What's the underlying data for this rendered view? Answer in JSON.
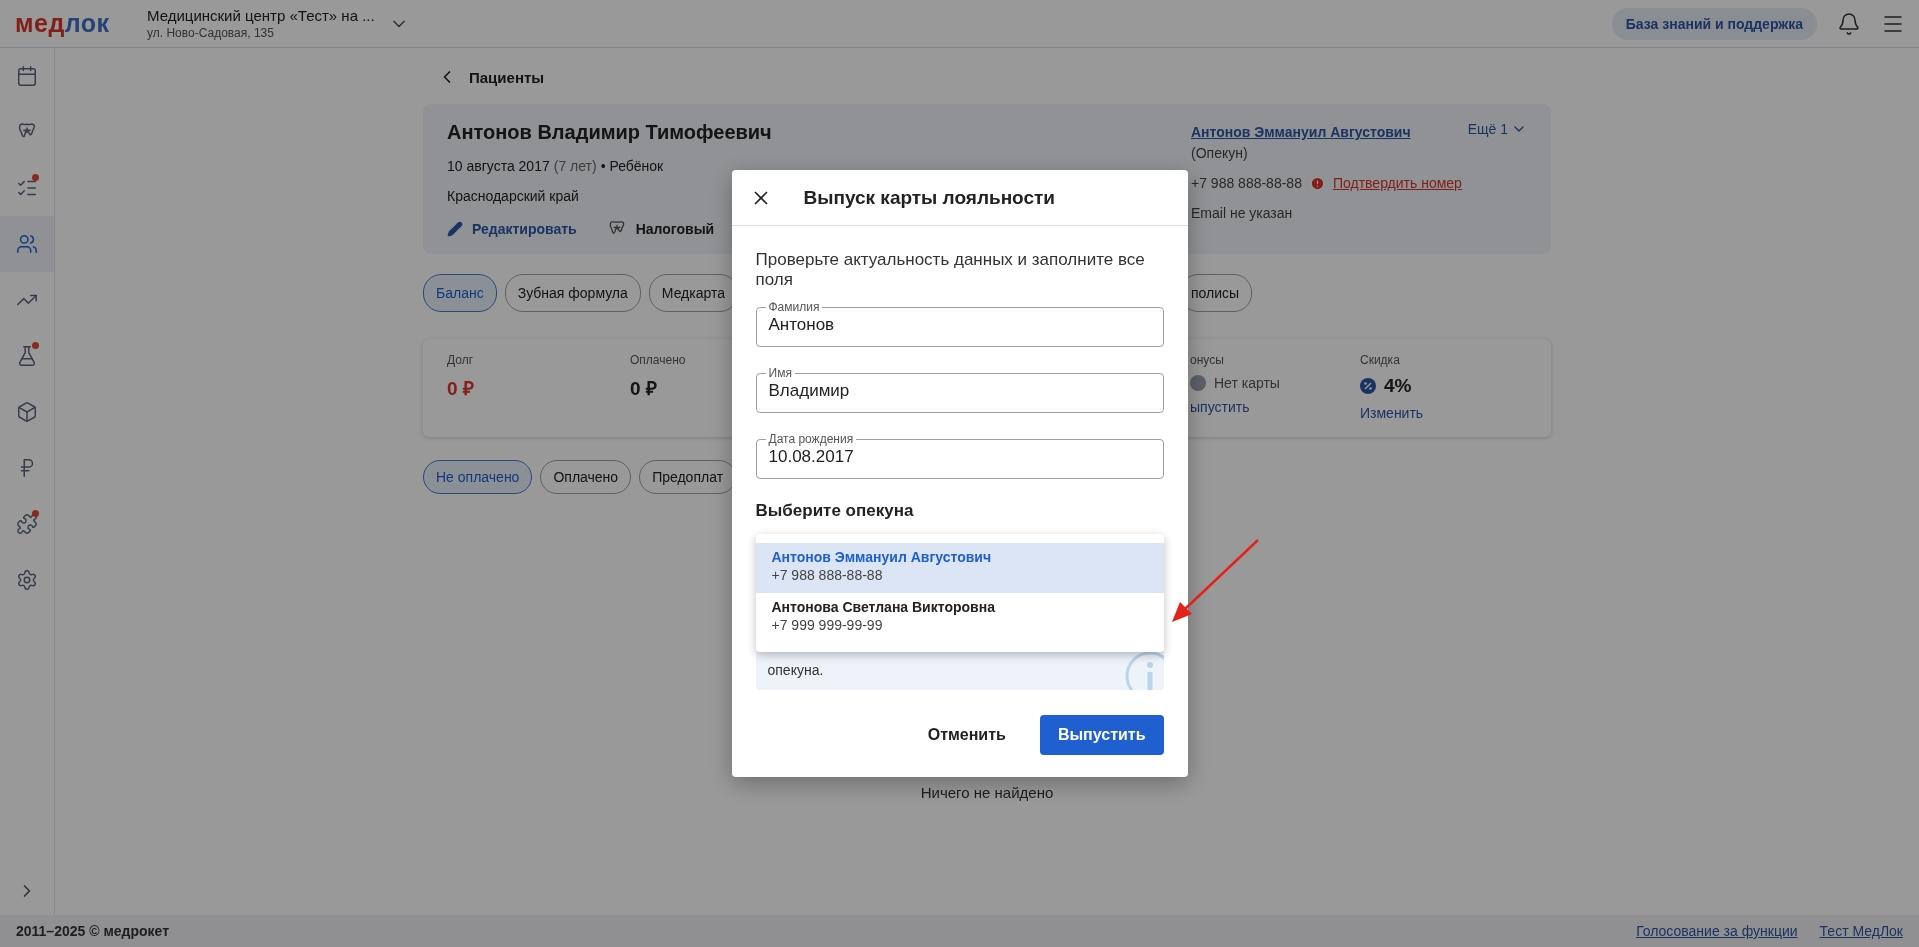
{
  "header": {
    "logo": {
      "first": "мед",
      "second": "лок"
    },
    "clinic": {
      "name": "Медицинский центр «Тест» на ...",
      "address": "ул. Ново-Садовая, 135"
    },
    "help_button": "База знаний и поддержка"
  },
  "sidebar": {
    "items": [
      {
        "selected": false,
        "badge": false
      },
      {
        "selected": false,
        "badge": false
      },
      {
        "selected": false,
        "badge": true
      },
      {
        "selected": true,
        "badge": false
      },
      {
        "selected": false,
        "badge": false
      },
      {
        "selected": false,
        "badge": true
      },
      {
        "selected": false,
        "badge": false
      },
      {
        "selected": false,
        "badge": false
      },
      {
        "selected": false,
        "badge": true
      },
      {
        "selected": false,
        "badge": false
      }
    ]
  },
  "back_link": "Пациенты",
  "patient": {
    "name": "Антонов Владимир Тимофеевич",
    "birth_date": "10 августа 2017",
    "age": "(7 лет)",
    "category": "• Ребёнок",
    "region": "Краснодарский край",
    "actions": [
      {
        "kind": "edit",
        "label": "Редактировать"
      },
      {
        "kind": "tax",
        "label": "Налоговый"
      }
    ],
    "guardian": {
      "name": "Антонов Эммануил Августович",
      "role": "(Опекун)",
      "phone": "+7 988 888-88-88",
      "phone_warning": "Подтвердить номер",
      "email": "Email не указан"
    },
    "more": "Ещё 1"
  },
  "tabs": [
    {
      "label": "Баланс",
      "selected": true
    },
    {
      "label": "Зубная формула",
      "selected": false
    },
    {
      "label": "Медкарта",
      "selected": false
    },
    {
      "label": "полисы",
      "selected": false
    }
  ],
  "balance": [
    {
      "kind": "debt",
      "label": "Долг",
      "value": "0 ₽"
    },
    {
      "kind": "amount",
      "label": "Оплачено",
      "value": "0 ₽"
    },
    {
      "kind": "bonus",
      "label": "онусы",
      "value": "Нет карты",
      "link": "ыпустить"
    },
    {
      "kind": "discount",
      "label": "Скидка",
      "value": "4%",
      "link": "Изменить"
    }
  ],
  "filters": [
    {
      "label": "Не оплачено",
      "selected": true
    },
    {
      "label": "Оплачено",
      "selected": false
    },
    {
      "label": "Предоплат",
      "selected": false
    }
  ],
  "empty_text": "Ничего не найдено",
  "modal": {
    "title": "Выпуск карты лояльности",
    "intro": "Проверьте актуальность данных и заполните все поля",
    "fields": [
      {
        "label": "Фамилия",
        "value": "Антонов"
      },
      {
        "label": "Имя",
        "value": "Владимир"
      },
      {
        "label": "Дата рождения",
        "value": "10.08.2017"
      }
    ],
    "guardian_heading": "Выберите опекуна",
    "guardian_options": [
      {
        "name": "Антонов Эммануил Августович",
        "phone": "+7 988 888-88-88",
        "selected": true
      },
      {
        "name": "Антонова Светлана Викторовна",
        "phone": "+7 999 999-99-99",
        "selected": false
      }
    ],
    "info_text": "опекуна.",
    "buttons": [
      {
        "kind": "secondary",
        "label": "Отменить"
      },
      {
        "kind": "primary",
        "label": "Выпустить"
      }
    ]
  },
  "footer": {
    "copyright": "2011–2025 © медрокет",
    "links": [
      "Голосование за функции",
      "Тест МедЛок"
    ]
  }
}
